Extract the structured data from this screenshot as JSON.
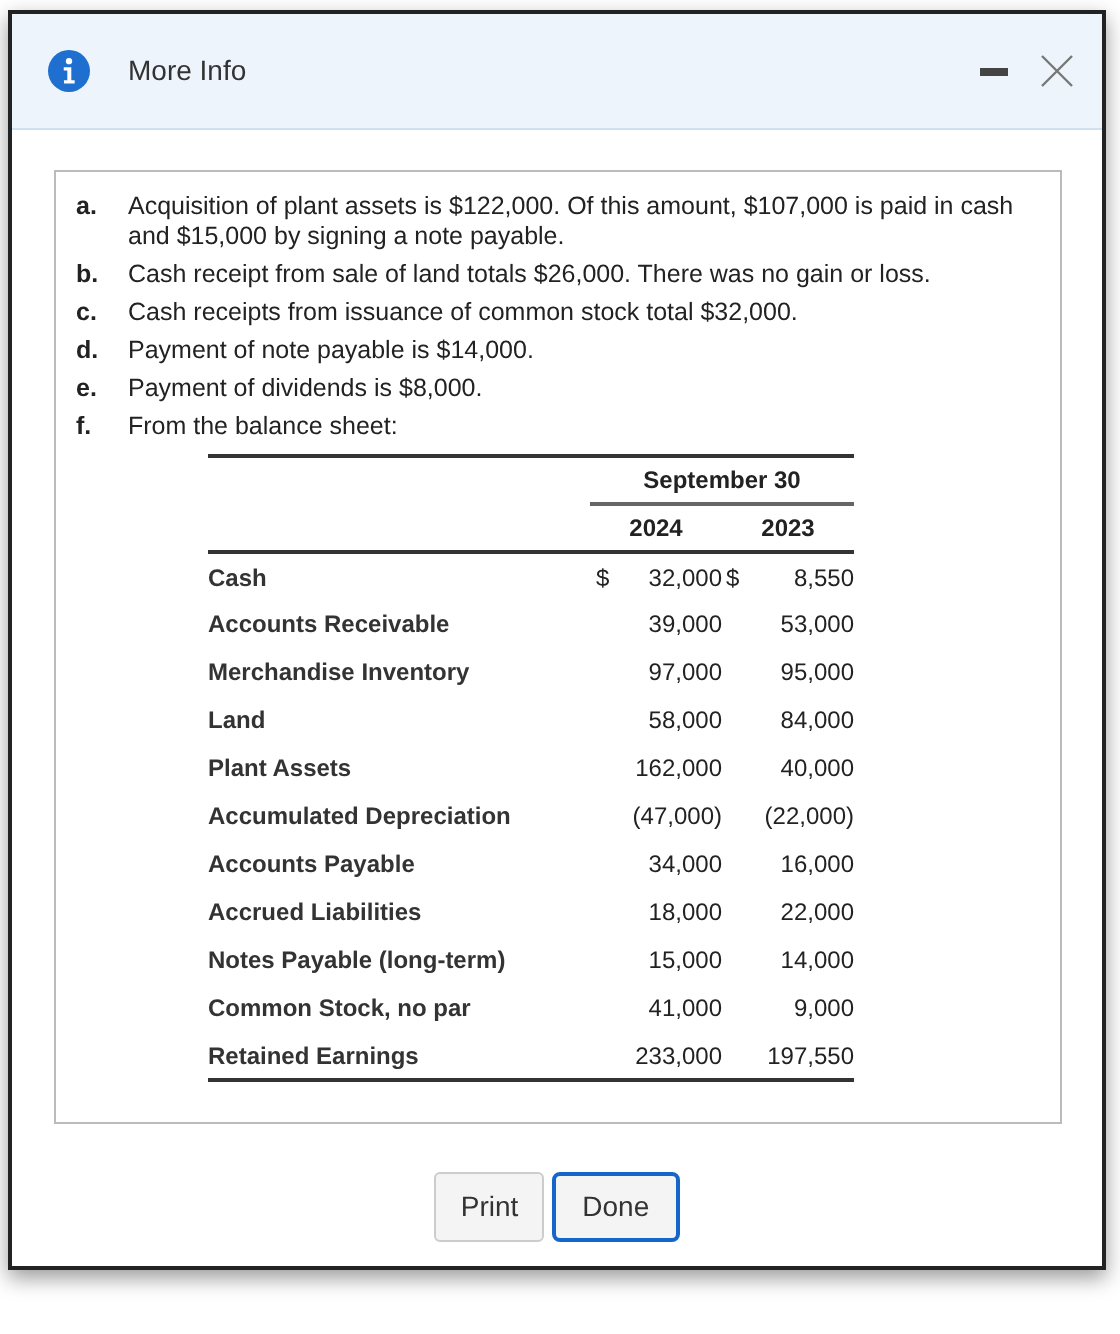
{
  "dialog": {
    "title": "More Info"
  },
  "items": [
    {
      "letter": "a.",
      "text": "Acquisition of plant assets is $122,000. Of this amount, $107,000 is paid in cash and $15,000 by signing a note payable."
    },
    {
      "letter": "b.",
      "text": "Cash receipt from sale of land totals $26,000. There was no gain or loss."
    },
    {
      "letter": "c.",
      "text": "Cash receipts from issuance of common stock total $32,000."
    },
    {
      "letter": "d.",
      "text": "Payment of note payable is $14,000."
    },
    {
      "letter": "e.",
      "text": "Payment of dividends is $8,000."
    },
    {
      "letter": "f.",
      "text": "From the balance sheet:"
    }
  ],
  "table": {
    "group_heading": "September 30",
    "columns": [
      "2024",
      "2023"
    ],
    "rows": [
      {
        "label": "Cash",
        "cells": [
          {
            "currency": "$",
            "value": "32,000"
          },
          {
            "currency": "$",
            "value": "8,550"
          }
        ]
      },
      {
        "label": "Accounts Receivable",
        "cells": [
          {
            "value": "39,000"
          },
          {
            "value": "53,000"
          }
        ]
      },
      {
        "label": "Merchandise Inventory",
        "cells": [
          {
            "value": "97,000"
          },
          {
            "value": "95,000"
          }
        ]
      },
      {
        "label": "Land",
        "cells": [
          {
            "value": "58,000"
          },
          {
            "value": "84,000"
          }
        ]
      },
      {
        "label": "Plant Assets",
        "cells": [
          {
            "value": "162,000"
          },
          {
            "value": "40,000"
          }
        ]
      },
      {
        "label": "Accumulated Depreciation",
        "cells": [
          {
            "value": "(47,000)"
          },
          {
            "value": "(22,000)"
          }
        ]
      },
      {
        "label": "Accounts Payable",
        "cells": [
          {
            "value": "34,000"
          },
          {
            "value": "16,000"
          }
        ]
      },
      {
        "label": "Accrued Liabilities",
        "cells": [
          {
            "value": "18,000"
          },
          {
            "value": "22,000"
          }
        ]
      },
      {
        "label": "Notes Payable (long-term)",
        "cells": [
          {
            "value": "15,000"
          },
          {
            "value": "14,000"
          }
        ]
      },
      {
        "label": "Common Stock, no par",
        "cells": [
          {
            "value": "41,000"
          },
          {
            "value": "9,000"
          }
        ]
      },
      {
        "label": "Retained Earnings",
        "cells": [
          {
            "value": "233,000"
          },
          {
            "value": "197,550"
          }
        ]
      }
    ]
  },
  "buttons": [
    {
      "label": "Print",
      "focused": false
    },
    {
      "label": "Done",
      "focused": true
    }
  ]
}
